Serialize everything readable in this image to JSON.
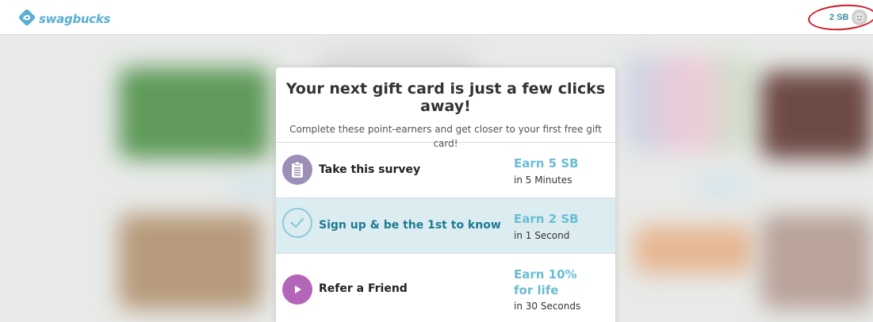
{
  "header": {
    "logo_text": "swagbucks",
    "balance": "2 SB"
  },
  "modal": {
    "title": "Your next gift card is just a few clicks away!",
    "subtitle": "Complete these point-earners and get closer to your first free gift card!",
    "items": [
      {
        "label": "Take this survey",
        "earn": "Earn 5 SB",
        "time": "in 5 Minutes",
        "icon": "clipboard-icon",
        "color": "#9b8fb8"
      },
      {
        "label": "Sign up & be the 1st to know",
        "earn": "Earn 2 SB",
        "time": "in 1 Second",
        "icon": "check-circle-icon",
        "color": "#8cc9d8"
      },
      {
        "label": "Refer a Friend",
        "earn": "Earn 10% for life",
        "time": "in 30 Seconds",
        "icon": "play-icon",
        "color": "#b366b8"
      }
    ]
  },
  "colors": {
    "brand": "#5aaed0",
    "highlight_ring": "#d01a2a",
    "active_row": "#dcedf2",
    "earn_text": "#6bbcd4"
  }
}
